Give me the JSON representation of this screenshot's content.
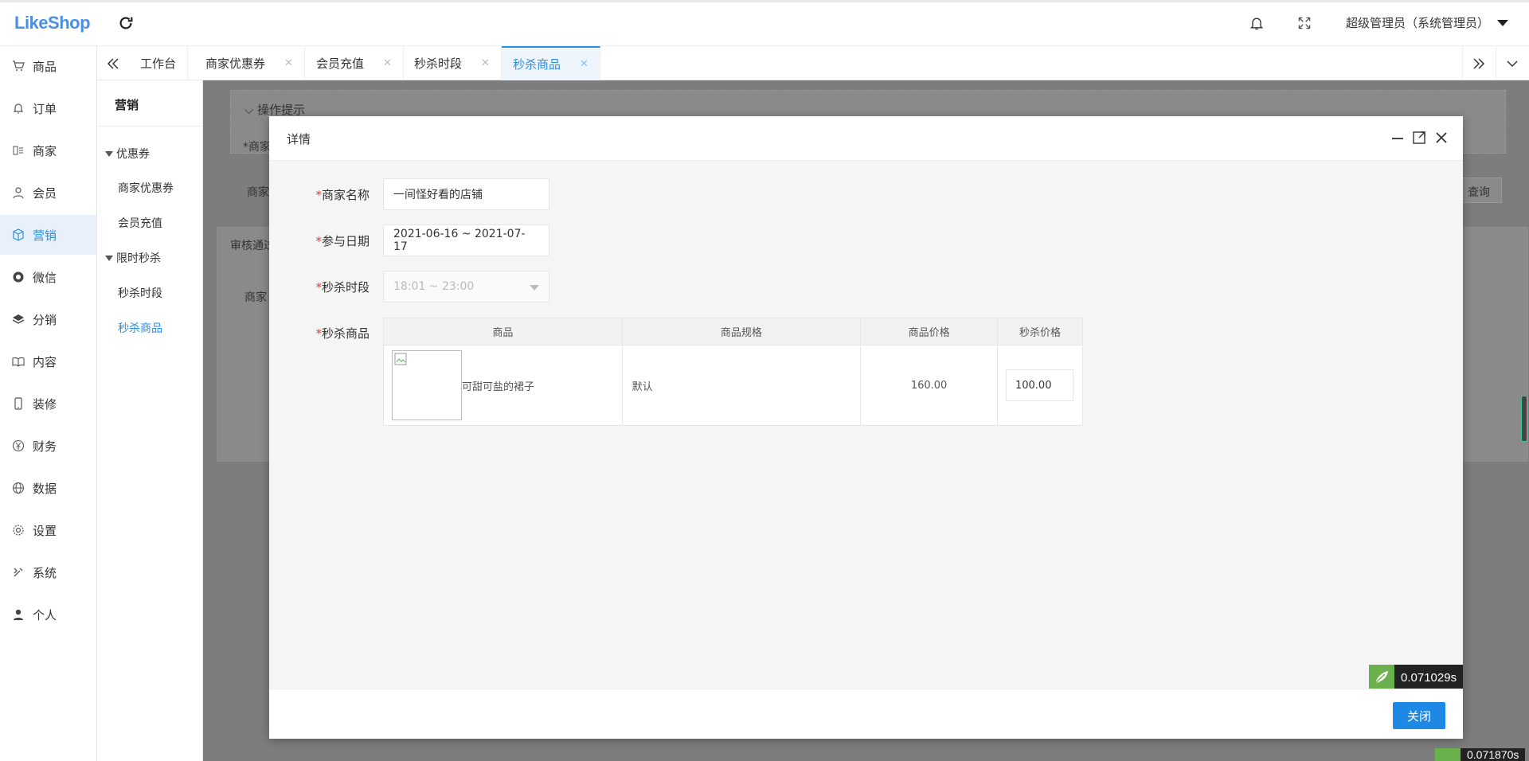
{
  "app": {
    "logo": "LikeShop"
  },
  "header": {
    "refresh_icon": "refresh-icon",
    "bell_icon": "bell-icon",
    "fullscreen_icon": "fullscreen-icon",
    "user_label": "超级管理员（系统管理员）"
  },
  "sidebar": {
    "items": [
      {
        "label": "商品",
        "icon": "cart-icon"
      },
      {
        "label": "订单",
        "icon": "bell-icon"
      },
      {
        "label": "商家",
        "icon": "store-icon"
      },
      {
        "label": "会员",
        "icon": "user-icon"
      },
      {
        "label": "营销",
        "icon": "cube-icon",
        "active": true
      },
      {
        "label": "微信",
        "icon": "wechat-icon"
      },
      {
        "label": "分销",
        "icon": "layers-icon"
      },
      {
        "label": "内容",
        "icon": "book-icon"
      },
      {
        "label": "装修",
        "icon": "phone-icon"
      },
      {
        "label": "财务",
        "icon": "yen-icon"
      },
      {
        "label": "数据",
        "icon": "globe-icon"
      },
      {
        "label": "设置",
        "icon": "gear-icon"
      },
      {
        "label": "系统",
        "icon": "tools-icon"
      },
      {
        "label": "个人",
        "icon": "person-icon"
      }
    ]
  },
  "tabs": [
    {
      "label": "工作台",
      "closable": false
    },
    {
      "label": "商家优惠券",
      "closable": true
    },
    {
      "label": "会员充值",
      "closable": true
    },
    {
      "label": "秒杀时段",
      "closable": true
    },
    {
      "label": "秒杀商品",
      "closable": true,
      "active": true
    }
  ],
  "tab_close_glyph": "✕",
  "subnav": {
    "title": "营销",
    "groups": [
      {
        "label": "优惠券",
        "items": [
          "商家优惠券",
          "会员充值"
        ]
      },
      {
        "label": "限时秒杀",
        "items": [
          "秒杀时段",
          "秒杀商品"
        ]
      }
    ]
  },
  "background_page": {
    "tip_title": "操作提示",
    "tip_prefix": "*商家",
    "filter_label": "商家",
    "query_button": "查询",
    "tab_label": "审核通过",
    "table_head": "商家"
  },
  "modal": {
    "title": "详情",
    "fields": {
      "merchant_name": {
        "label": "商家名称",
        "value": "一间怪好看的店铺"
      },
      "date_range": {
        "label": "参与日期",
        "value": "2021-06-16 ~ 2021-07-17"
      },
      "time_slot": {
        "label": "秒杀时段",
        "value": "18:01 ~ 23:00"
      },
      "goods": {
        "label": "秒杀商品"
      }
    },
    "required_mark": "*",
    "table": {
      "headers": [
        "商品",
        "商品规格",
        "商品价格",
        "秒杀价格"
      ],
      "rows": [
        {
          "name": "可甜可盐的裙子",
          "spec": "默认",
          "price": "160.00",
          "seckill_price": "100.00"
        }
      ]
    },
    "close_button": "关闭"
  },
  "timers": {
    "primary": "0.071029s",
    "secondary": "0.071870s"
  }
}
